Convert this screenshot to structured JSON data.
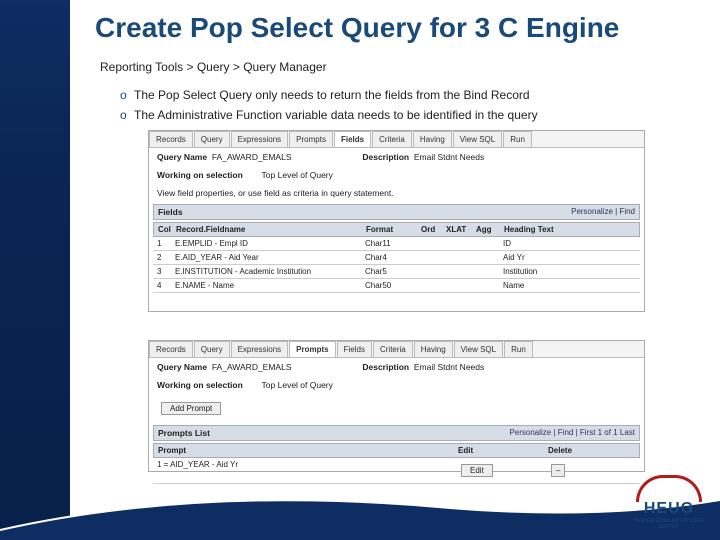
{
  "title": "Create Pop Select Query for 3 C Engine",
  "breadcrumb": "Reporting Tools > Query > Query Manager",
  "bullets": [
    "The Pop Select Query only needs to return the fields from the Bind Record",
    "The Administrative Function variable data needs to be identified in the query"
  ],
  "shot1": {
    "tabs": [
      "Records",
      "Query",
      "Expressions",
      "Prompts",
      "Fields",
      "Criteria",
      "Having",
      "View SQL",
      "Run"
    ],
    "active": 4,
    "query_label": "Query Name",
    "query_name": "FA_AWARD_EMALS",
    "desc_label": "Description",
    "desc_val": "Email Stdnt Needs",
    "working": "Working on selection",
    "toplevel": "Top Level of Query",
    "hint": "View field properties, or use field as criteria in query statement.",
    "bar_title": "Fields",
    "bar_right": "Personalize | Find",
    "head": [
      "Col",
      "Record.Fieldname",
      "Format",
      "Ord",
      "XLAT",
      "Agg",
      "Heading Text"
    ],
    "rows": [
      {
        "col": "1",
        "rec": "E.EMPLID - Empl ID",
        "fmt": "Char11",
        "head": "ID"
      },
      {
        "col": "2",
        "rec": "E.AID_YEAR - Aid Year",
        "fmt": "Char4",
        "head": "Aid Yr"
      },
      {
        "col": "3",
        "rec": "E.INSTITUTION - Academic Institution",
        "fmt": "Char5",
        "head": "Institution"
      },
      {
        "col": "4",
        "rec": "E.NAME - Name",
        "fmt": "Char50",
        "head": "Name"
      }
    ]
  },
  "shot2": {
    "tabs": [
      "Records",
      "Query",
      "Expressions",
      "Prompts",
      "Fields",
      "Criteria",
      "Having",
      "View SQL",
      "Run"
    ],
    "active": 3,
    "query_label": "Query Name",
    "query_name": "FA_AWARD_EMALS",
    "desc_label": "Description",
    "desc_val": "Email Stdnt Needs",
    "working": "Working on selection",
    "toplevel": "Top Level of Query",
    "add_btn": "Add Prompt",
    "bar_title": "Prompts List",
    "bar_right": "Personalize | Find |   First   1 of 1   Last",
    "head_prompt": "Prompt",
    "head_edit": "Edit",
    "head_del": "Delete",
    "row_prompt": "1 = AID_YEAR - Aid Yr",
    "edit_btn": "Edit"
  },
  "logo": {
    "text": "HEUG",
    "sub": "HIGHER EDUCATION USER GROUP"
  }
}
